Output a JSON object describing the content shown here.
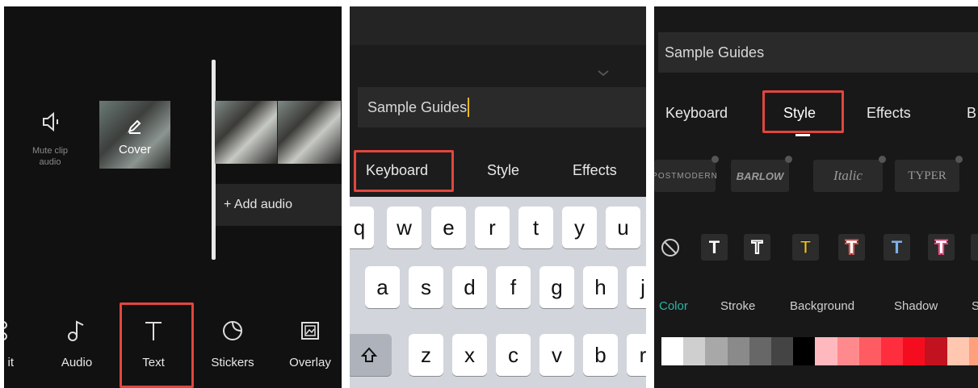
{
  "panel1": {
    "mute_label_line1": "Mute clip",
    "mute_label_line2": "audio",
    "cover_label": "Cover",
    "add_audio_label": "+ Add audio",
    "toolbar": [
      {
        "label": "it",
        "icon": "edit-icon"
      },
      {
        "label": "Audio",
        "icon": "music-note-icon"
      },
      {
        "label": "Text",
        "icon": "text-t-icon"
      },
      {
        "label": "Stickers",
        "icon": "sticker-icon"
      },
      {
        "label": "Overlay",
        "icon": "overlay-icon"
      }
    ]
  },
  "panel2": {
    "text_value": "Sample Guides",
    "tabs": [
      "Keyboard",
      "Style",
      "Effects"
    ],
    "keyboard": {
      "row1": [
        "q",
        "w",
        "e",
        "r",
        "t",
        "y",
        "u"
      ],
      "row2": [
        "a",
        "s",
        "d",
        "f",
        "g",
        "h",
        "j"
      ],
      "row3": [
        "z",
        "x",
        "c",
        "v",
        "b",
        "r"
      ]
    }
  },
  "panel3": {
    "text_value": "Sample Guides",
    "tabs": [
      "Keyboard",
      "Style",
      "Effects",
      "B"
    ],
    "fonts": [
      "POSTMODERN",
      "BARLOW",
      "Italic",
      "TYPER"
    ],
    "style_preset_letter": "T",
    "subtabs": [
      "Color",
      "Stroke",
      "Background",
      "Shadow",
      "S"
    ],
    "accent_color": "#2bb5a7",
    "swatches": [
      "#ffffff",
      "#cfcfcf",
      "#a8a8a8",
      "#8a8a8a",
      "#676767",
      "#444444",
      "#000000",
      "#ffb8bd",
      "#ff8a8e",
      "#ff5b62",
      "#ff2e3f",
      "#f50d1f",
      "#c2121f",
      "#ffc6b0",
      "#ff9f7c"
    ]
  }
}
